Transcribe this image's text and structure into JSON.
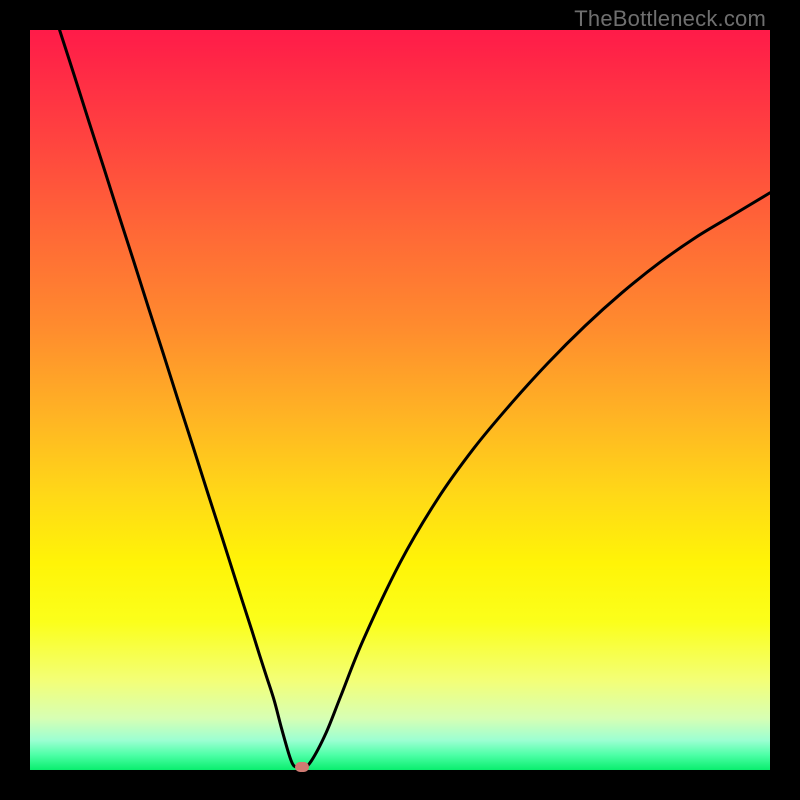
{
  "watermark": "TheBottleneck.com",
  "colors": {
    "frame": "#000000",
    "curve_stroke": "#000000",
    "marker_fill": "#cf7a72",
    "gradient_top": "#ff1b49",
    "gradient_bottom": "#0aee6e"
  },
  "chart_data": {
    "type": "line",
    "title": "",
    "xlabel": "",
    "ylabel": "",
    "xlim": [
      0,
      100
    ],
    "ylim": [
      0,
      100
    ],
    "grid": false,
    "legend": false,
    "annotations": [],
    "x": [
      4,
      6,
      8,
      10,
      12,
      14,
      16,
      18,
      20,
      22,
      24,
      26,
      28,
      30,
      31,
      32,
      33,
      34,
      35,
      35.5,
      36,
      37,
      38,
      40,
      42,
      45,
      50,
      55,
      60,
      65,
      70,
      75,
      80,
      85,
      90,
      95,
      100
    ],
    "values": [
      100,
      93.8,
      87.5,
      81.3,
      75.0,
      68.8,
      62.5,
      56.3,
      50.0,
      43.8,
      37.5,
      31.3,
      25.0,
      18.8,
      15.6,
      12.5,
      9.4,
      5.6,
      2.1,
      0.8,
      0.4,
      0.4,
      1.2,
      5.0,
      10.0,
      17.5,
      28.0,
      36.5,
      43.5,
      49.5,
      55.0,
      60.0,
      64.5,
      68.5,
      72.0,
      75.0,
      78.0
    ],
    "marker": {
      "x": 36.8,
      "y": 0.4
    }
  }
}
